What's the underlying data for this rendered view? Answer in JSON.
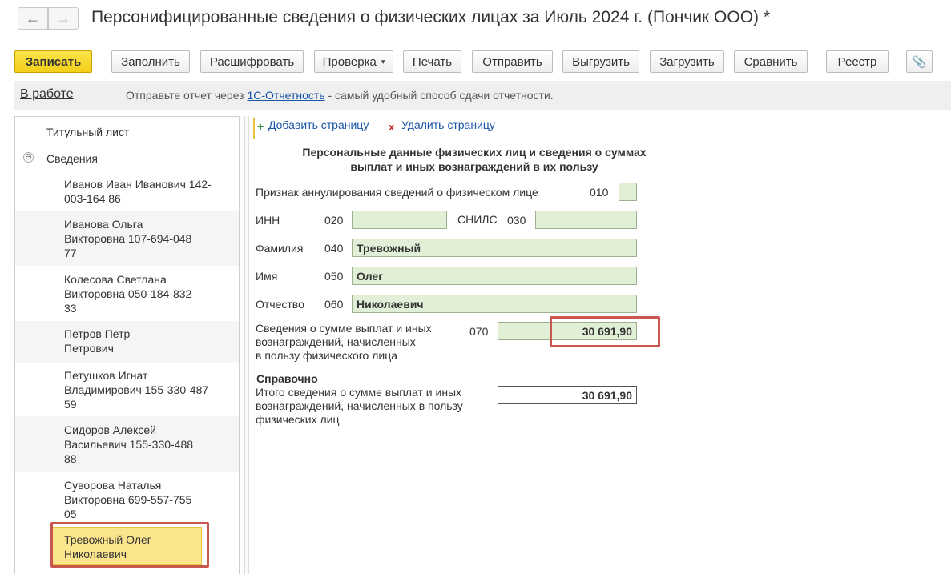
{
  "window": {
    "title": "Персонифицированные сведения о физических лицах за Июль 2024 г. (Пончик ООО) *",
    "back_icon": "←",
    "forward_icon": "→"
  },
  "toolbar": {
    "save": "Записать",
    "fill": "Заполнить",
    "decode": "Расшифровать",
    "check": "Проверка",
    "check_caret": "▾",
    "print": "Печать",
    "send": "Отправить",
    "export": "Выгрузить",
    "import": "Загрузить",
    "compare": "Сравнить",
    "registry": "Реестр",
    "attach_icon": "📎"
  },
  "status": {
    "state": "В работе",
    "msg_prefix": "Отправьте отчет через ",
    "msg_link": "1С-Отчетность",
    "msg_suffix": " - самый удобный способ сдачи отчетности."
  },
  "tree": {
    "title_page": "Титульный лист",
    "section": "Сведения",
    "toggle_icon": "⊖",
    "people": [
      {
        "line1": "Иванов Иван Иванович 142-",
        "line2": "003-164 86",
        "line3": ""
      },
      {
        "line1": "Иванова Ольга",
        "line2": "Викторовна 107-694-048",
        "line3": "77"
      },
      {
        "line1": "Колесова Светлана",
        "line2": "Викторовна 050-184-832",
        "line3": "33"
      },
      {
        "line1": "Петров Петр",
        "line2": "Петрович",
        "line3": ""
      },
      {
        "line1": "Петушков Игнат",
        "line2": "Владимирович 155-330-487",
        "line3": "59"
      },
      {
        "line1": "Сидоров Алексей",
        "line2": "Васильевич 155-330-488",
        "line3": "88"
      },
      {
        "line1": "Суворова Наталья",
        "line2": "Викторовна 699-557-755",
        "line3": "05"
      },
      {
        "line1": "Тревожный Олег",
        "line2": "Николаевич",
        "line3": ""
      }
    ]
  },
  "form": {
    "add_page": "Добавить страницу",
    "delete_page": "Удалить страницу",
    "plus_icon": "+",
    "x_icon": "x",
    "heading_line1": "Персональные данные физических лиц и сведения о суммах",
    "heading_line2": "выплат и иных вознаграждений в их пользу",
    "annul_label": "Признак аннулирования сведений о физическом лице",
    "annul_code": "010",
    "inn_label": "ИНН",
    "inn_code": "020",
    "inn_value": "",
    "snils_label": "СНИЛС",
    "snils_code": "030",
    "snils_value": "",
    "surname_label": "Фамилия",
    "surname_code": "040",
    "surname_value": "Тревожный",
    "name_label": "Имя",
    "name_code": "050",
    "name_value": "Олег",
    "patronymic_label": "Отчество",
    "patronymic_code": "060",
    "patronymic_value": "Николаевич",
    "payments_label_1": "Сведения о сумме выплат и иных",
    "payments_label_2": "вознаграждений, начисленных",
    "payments_label_3": "в пользу физического лица",
    "payments_code": "070",
    "payments_value": "30 691,90",
    "reference_title": "Справочно",
    "total_label_1": "Итого сведения о сумме выплат и иных",
    "total_label_2": "вознаграждений, начисленных в пользу",
    "total_label_3": "физических лиц",
    "total_value": "30 691,90"
  },
  "colors": {
    "highlight": "#c7574f",
    "field_green": "#e1efd7",
    "primary_yellow": "#f4cf18",
    "link_blue": "#1a56a8"
  }
}
